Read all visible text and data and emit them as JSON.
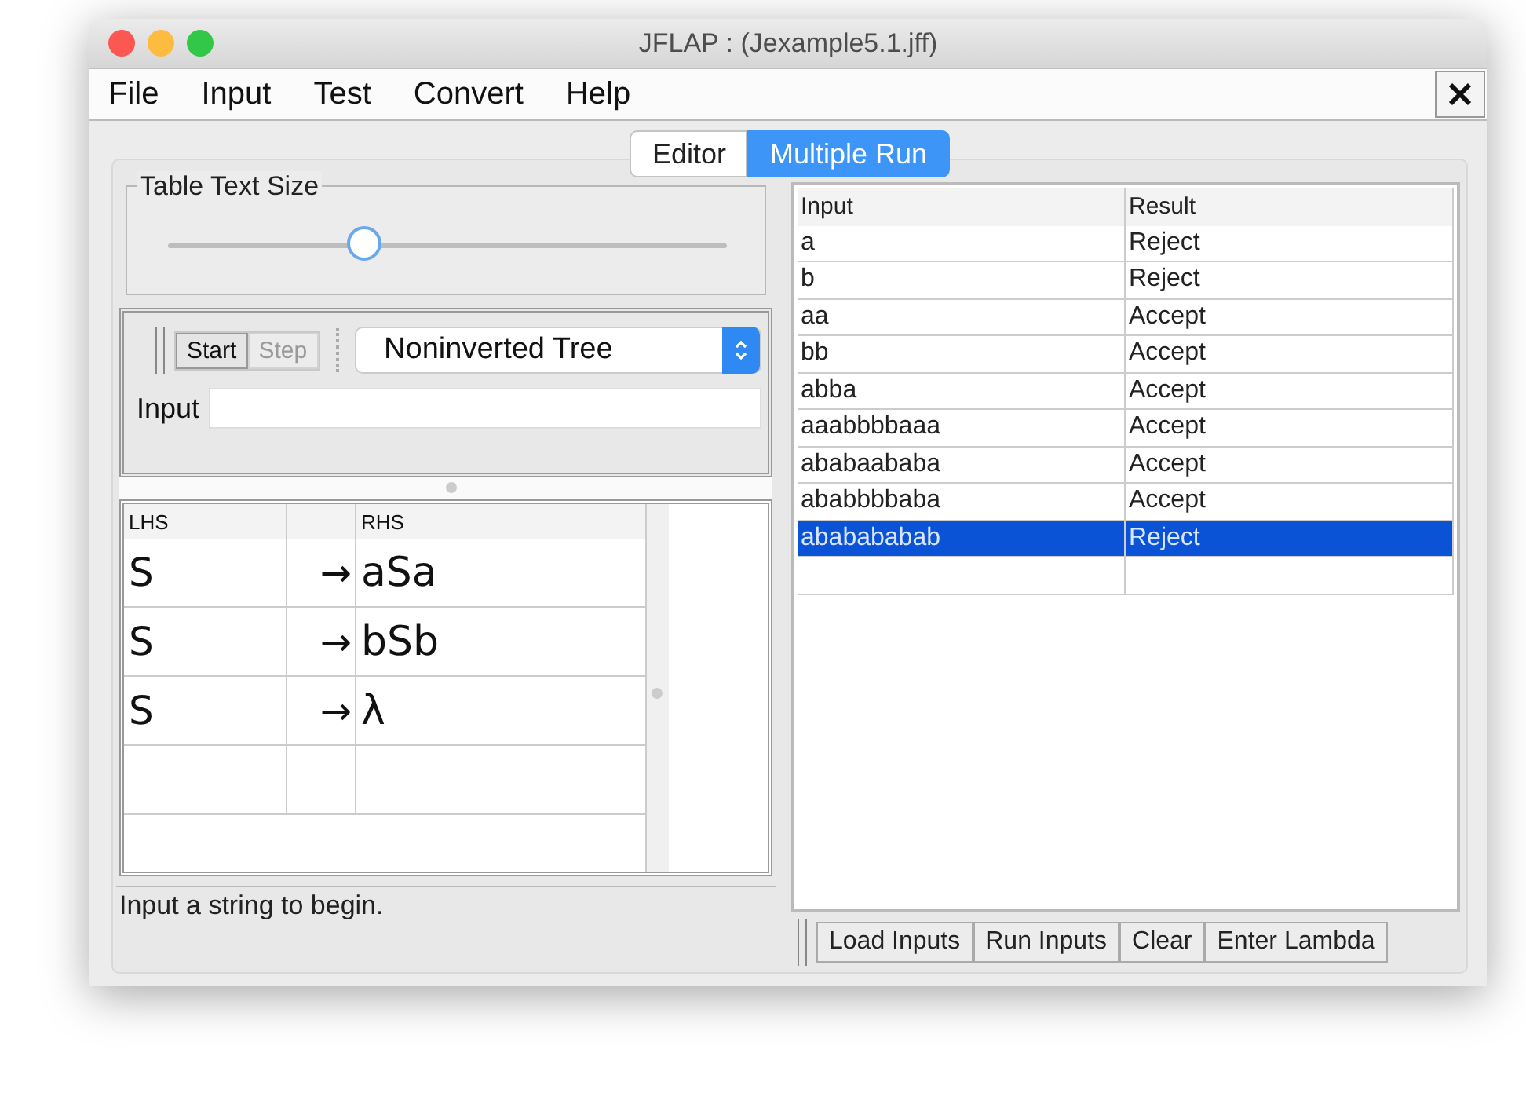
{
  "window": {
    "title": "JFLAP : (Jexample5.1.jff)"
  },
  "menu": [
    "File",
    "Input",
    "Test",
    "Convert",
    "Help"
  ],
  "tabs": [
    {
      "label": "Editor",
      "selected": false
    },
    {
      "label": "Multiple Run",
      "selected": true
    }
  ],
  "text_size": {
    "label": "Table Text Size",
    "level": 0.35
  },
  "toolbar": [
    {
      "label": "Start",
      "disabled": false
    },
    {
      "label": "Step",
      "disabled": true
    }
  ],
  "view_select": {
    "value": "Noninverted Tree"
  },
  "input_field": {
    "label": "Input"
  },
  "grammar": {
    "columns": [
      "LHS",
      "RHS"
    ],
    "rows": [
      {
        "lhs": "S",
        "arrow": "→",
        "rhs": "aSa"
      },
      {
        "lhs": "S",
        "arrow": "→",
        "rhs": "bSb"
      },
      {
        "lhs": "S",
        "arrow": "→",
        "rhs": "λ"
      }
    ]
  },
  "runs": {
    "columns": [
      "Input",
      "Result"
    ],
    "rows": [
      {
        "input": "a",
        "result": "Reject",
        "selected": false
      },
      {
        "input": "b",
        "result": "Reject",
        "selected": false
      },
      {
        "input": "aa",
        "result": "Accept",
        "selected": false
      },
      {
        "input": "bb",
        "result": "Accept",
        "selected": false
      },
      {
        "input": "abba",
        "result": "Accept",
        "selected": false
      },
      {
        "input": "aaabbbbaaa",
        "result": "Accept",
        "selected": false
      },
      {
        "input": "ababaababa",
        "result": "Accept",
        "selected": false
      },
      {
        "input": "ababbbbaba",
        "result": "Accept",
        "selected": false
      },
      {
        "input": "ababababab",
        "result": "Reject",
        "selected": true
      }
    ]
  },
  "run_buttons": [
    "Load Inputs",
    "Run Inputs",
    "Clear",
    "Enter Lambda"
  ],
  "status_bar": "Input a string to begin."
}
